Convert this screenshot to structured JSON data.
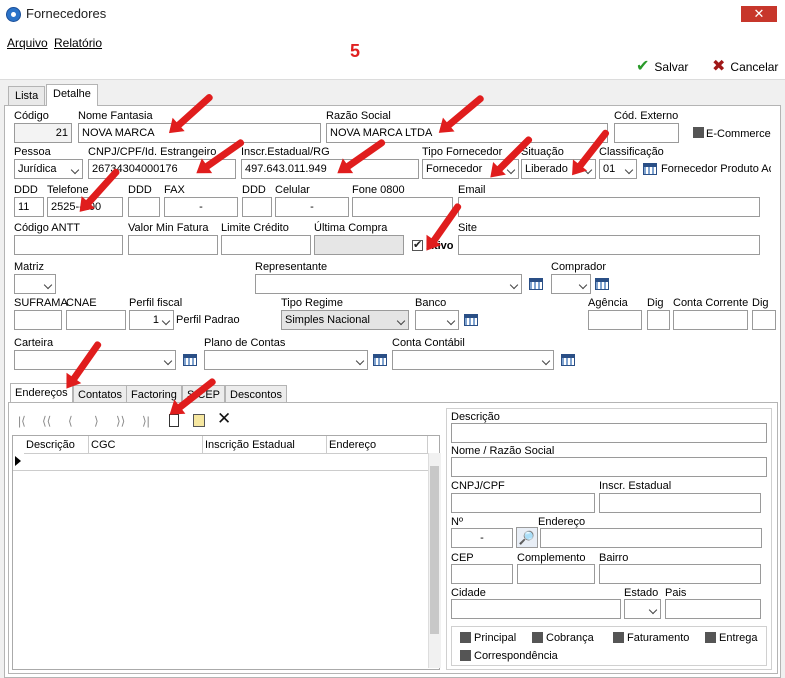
{
  "window": {
    "title": "Fornecedores",
    "close_glyph": "✕",
    "step_badge": "5"
  },
  "menu": {
    "arquivo": "Arquivo",
    "relatorio": "Relatório"
  },
  "toolbar": {
    "save_label": "Salvar",
    "cancel_label": "Cancelar"
  },
  "tabs": {
    "lista": "Lista",
    "detalhe": "Detalhe"
  },
  "form": {
    "codigo": {
      "label": "Código",
      "value": "21"
    },
    "nome_fantasia": {
      "label": "Nome Fantasia",
      "value": "NOVA MARCA"
    },
    "razao_social": {
      "label": "Razão Social",
      "value": "NOVA MARCA LTDA"
    },
    "cod_externo": {
      "label": "Cód. Externo",
      "value": ""
    },
    "ecommerce": {
      "label": "E-Commerce",
      "checked": false
    },
    "pessoa": {
      "label": "Pessoa",
      "value": "Jurídica"
    },
    "cnpj": {
      "label": "CNPJ/CPF/Id. Estrangeiro",
      "value": "26734304000176"
    },
    "inscr_estadual": {
      "label": "Inscr.Estadual/RG",
      "value": "497.643.011.949"
    },
    "tipo_fornecedor": {
      "label": "Tipo Fornecedor",
      "value": "Fornecedor"
    },
    "situacao": {
      "label": "Situação",
      "value": "Liberado"
    },
    "classificacao": {
      "label": "Classificação",
      "value": "01",
      "desc": "Fornecedor Produto Ac"
    },
    "ddd1": {
      "label": "DDD",
      "value": "11"
    },
    "telefone": {
      "label": "Telefone",
      "value": "2525--200"
    },
    "ddd2": {
      "label": "DDD",
      "value": ""
    },
    "fax": {
      "label": "FAX",
      "value": "-"
    },
    "ddd3": {
      "label": "DDD",
      "value": ""
    },
    "celular": {
      "label": "Celular",
      "value": "-"
    },
    "fone0800": {
      "label": "Fone 0800",
      "value": ""
    },
    "email": {
      "label": "Email",
      "value": ""
    },
    "codigo_antt": {
      "label": "Código ANTT",
      "value": ""
    },
    "valor_min_fatura": {
      "label": "Valor Min Fatura",
      "value": ""
    },
    "limite_credito": {
      "label": "Limite Crédito",
      "value": ""
    },
    "ultima_compra": {
      "label": "Última Compra",
      "value": ""
    },
    "ativo": {
      "label": "Ativo",
      "checked": true
    },
    "site": {
      "label": "Site",
      "value": ""
    },
    "matriz": {
      "label": "Matriz",
      "value": ""
    },
    "representante": {
      "label": "Representante",
      "value": ""
    },
    "comprador": {
      "label": "Comprador",
      "value": ""
    },
    "suframa": {
      "label": "SUFRAMA",
      "value": ""
    },
    "cnae": {
      "label": "CNAE",
      "value": ""
    },
    "perfil_fiscal": {
      "label": "Perfil fiscal",
      "value": "1",
      "desc": "Perfil Padrao"
    },
    "tipo_regime": {
      "label": "Tipo Regime",
      "value": "Simples Nacional"
    },
    "banco": {
      "label": "Banco",
      "value": ""
    },
    "agencia": {
      "label": "Agência",
      "value": ""
    },
    "dig1": {
      "label": "Dig",
      "value": ""
    },
    "conta_corrente": {
      "label": "Conta Corrente",
      "value": ""
    },
    "dig2": {
      "label": "Dig",
      "value": ""
    },
    "carteira": {
      "label": "Carteira",
      "value": ""
    },
    "plano_contas": {
      "label": "Plano de Contas",
      "value": ""
    },
    "conta_contabil": {
      "label": "Conta Contábil",
      "value": ""
    }
  },
  "subtabs": {
    "enderecos": "Endereços",
    "contatos": "Contatos",
    "factoring": "Factoring",
    "sicep": "SICEP",
    "descontos": "Descontos"
  },
  "nav_icons": [
    "first-icon",
    "prior-page-icon",
    "prior-icon",
    "next-icon",
    "next-page-icon",
    "last-icon",
    "new-document-icon",
    "edit-document-icon",
    "delete-icon"
  ],
  "grid": {
    "columns": [
      "Descrição",
      "CGC",
      "Inscrição Estadual",
      "Endereço"
    ]
  },
  "address": {
    "descricao": "Descrição",
    "nome_razao": "Nome / Razão Social",
    "cnpj_cpf": "CNPJ/CPF",
    "inscr_estadual": "Inscr. Estadual",
    "numero": {
      "label": "Nº",
      "value": "-"
    },
    "endereco": "Endereço",
    "cep": "CEP",
    "complemento": "Complemento",
    "bairro": "Bairro",
    "cidade": "Cidade",
    "estado": "Estado",
    "pais": "Pais",
    "flags": {
      "principal": "Principal",
      "cobranca": "Cobrança",
      "faturamento": "Faturamento",
      "entrega": "Entrega",
      "correspondencia": "Correspondência"
    }
  },
  "colors": {
    "accent_red": "#e01d1d",
    "save_green": "#2a9a2a",
    "close_red": "#c7362b"
  }
}
